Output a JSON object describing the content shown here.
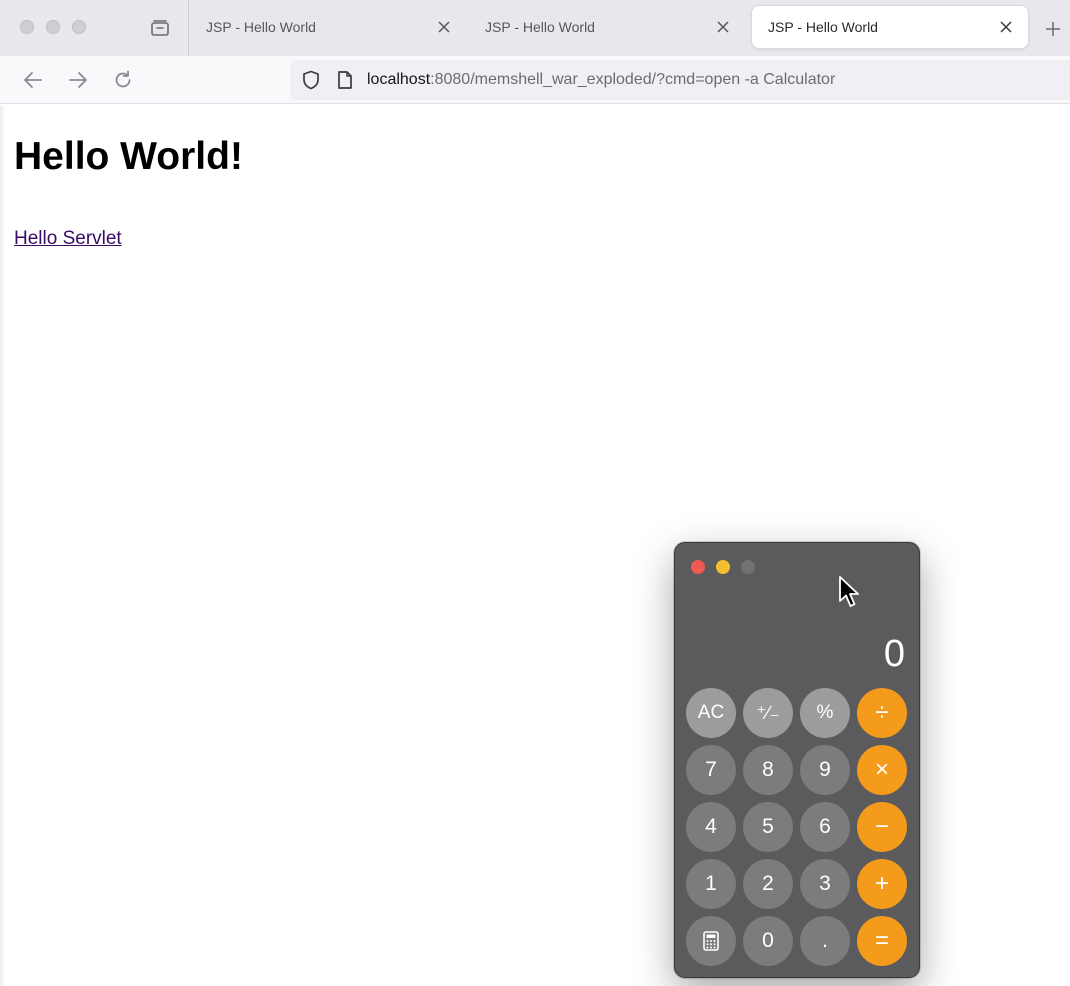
{
  "browser": {
    "tabs": [
      {
        "title": "JSP - Hello World",
        "active": false
      },
      {
        "title": "JSP - Hello World",
        "active": false
      },
      {
        "title": "JSP - Hello World",
        "active": true
      }
    ],
    "url_host": "localhost",
    "url_rest": ":8080/memshell_war_exploded/?cmd=open -a Calculator"
  },
  "page": {
    "heading": "Hello World!",
    "link": "Hello Servlet"
  },
  "calculator": {
    "display": "0",
    "keys": [
      "AC",
      "⁺∕₋",
      "%",
      "÷",
      "7",
      "8",
      "9",
      "×",
      "4",
      "5",
      "6",
      "−",
      "1",
      "2",
      "3",
      "+",
      "calculator-icon",
      "0",
      ".",
      "="
    ],
    "colors": {
      "operator": "#f59b1c",
      "function": "#9c9c9e",
      "number": "#7c7c7e",
      "body": "#5b5b5d"
    }
  }
}
